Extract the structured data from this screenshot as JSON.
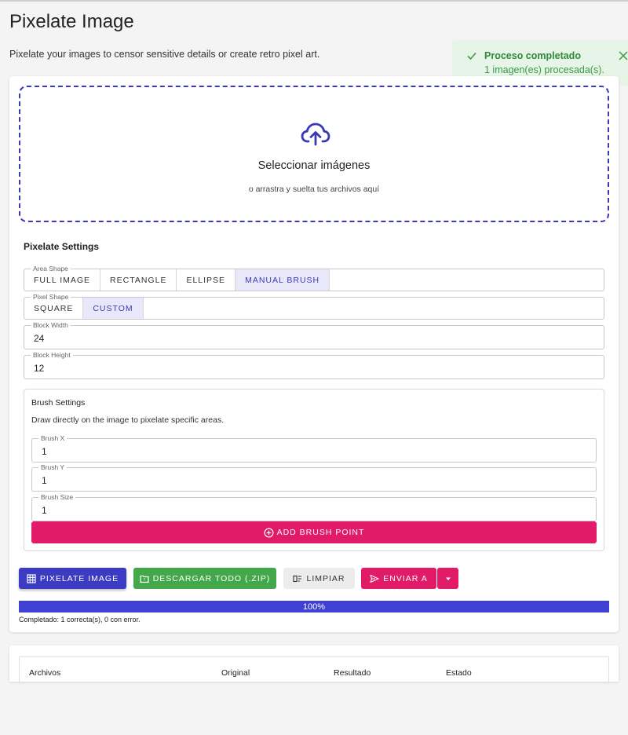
{
  "page": {
    "title": "Pixelate Image",
    "subtitle": "Pixelate your images to censor sensitive details or create retro pixel art."
  },
  "toast": {
    "title": "Proceso completado",
    "message": "1 imagen(es) procesada(s).",
    "color": "#2e8b3a"
  },
  "dropzone": {
    "title": "Seleccionar imágenes",
    "hint": "o arrastra y suelta tus archivos aquí",
    "icon": "cloud-upload-icon"
  },
  "settings": {
    "title": "Pixelate Settings",
    "area_shape": {
      "label": "Area Shape",
      "options": [
        "Full Image",
        "Rectangle",
        "Ellipse",
        "Manual Brush"
      ],
      "selected": "Manual Brush"
    },
    "pixel_shape": {
      "label": "Pixel Shape",
      "options": [
        "Square",
        "Custom"
      ],
      "selected": "Custom"
    },
    "block_width": {
      "label": "Block Width",
      "value": "24"
    },
    "block_height": {
      "label": "Block Height",
      "value": "12"
    }
  },
  "brush": {
    "title": "Brush Settings",
    "description": "Draw directly on the image to pixelate specific areas.",
    "brush_x": {
      "label": "Brush X",
      "value": "1"
    },
    "brush_y": {
      "label": "Brush Y",
      "value": "1"
    },
    "brush_size": {
      "label": "Brush Size",
      "value": "1"
    },
    "add_label": "Add Brush Point"
  },
  "actions": {
    "pixelate": "Pixelate Image",
    "download": "Descargar todo (.zip)",
    "clear": "Limpiar",
    "send": "Enviar a"
  },
  "progress": {
    "percent": 100,
    "label": "100%",
    "status": "Completado: 1 correcta(s), 0 con error."
  },
  "results_table": {
    "columns": [
      "Archivos",
      "Original",
      "Resultado",
      "Estado"
    ]
  },
  "colors": {
    "primary": "#3b3bc4",
    "accent": "#e11b68",
    "success": "#43a84a"
  }
}
